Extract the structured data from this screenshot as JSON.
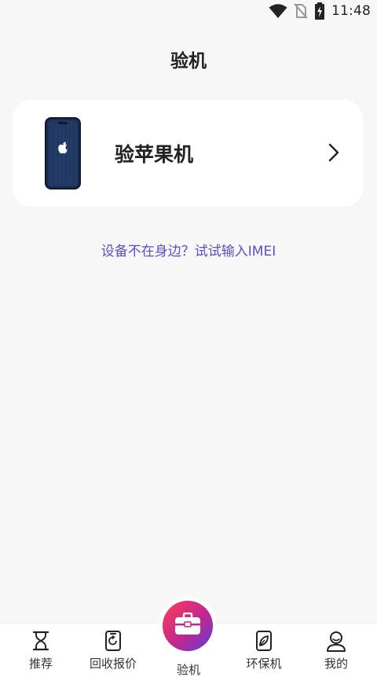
{
  "status_bar": {
    "time": "11:48",
    "icons": [
      "wifi-icon",
      "no-sim-icon",
      "battery-charging-icon"
    ]
  },
  "header": {
    "title": "验机"
  },
  "device_card": {
    "label": "验苹果机",
    "icon": "iphone-icon",
    "chevron": "chevron-right-icon"
  },
  "imei_link": {
    "text": "设备不在身边？试试输入IMEI",
    "color": "#5b4fc7"
  },
  "bottom_nav": {
    "items": [
      {
        "label": "推荐",
        "icon": "hourglass-icon"
      },
      {
        "label": "回收报价",
        "icon": "phone-refresh-icon"
      },
      {
        "label": "验机",
        "icon": "toolbox-icon",
        "active": true
      },
      {
        "label": "环保机",
        "icon": "leaf-phone-icon"
      },
      {
        "label": "我的",
        "icon": "user-icon"
      }
    ]
  },
  "colors": {
    "background": "#f7f7f7",
    "card": "#ffffff",
    "fab_gradient": [
      "#ff3d5a",
      "#c2278e",
      "#5a3fd6"
    ]
  }
}
